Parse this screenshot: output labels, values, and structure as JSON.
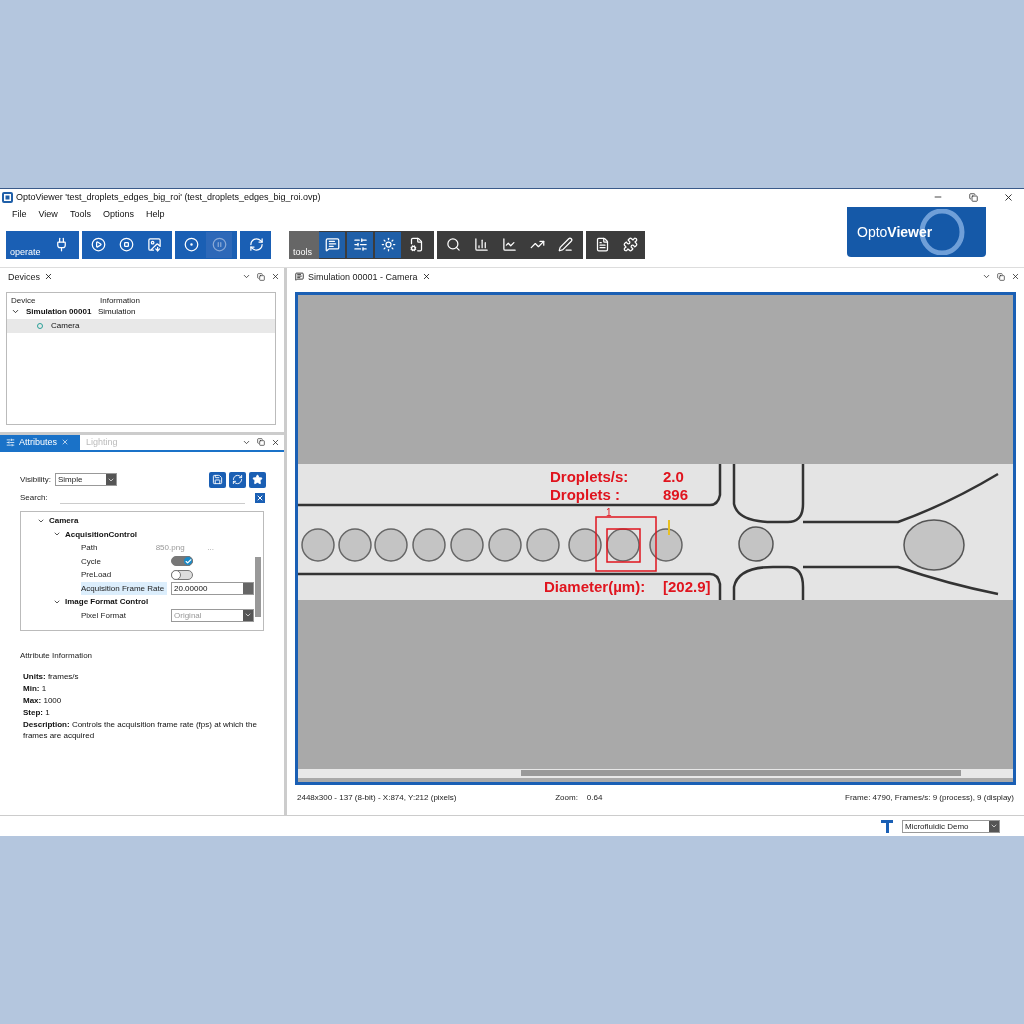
{
  "window": {
    "title": "OptoViewer 'test_droplets_edges_big_roi' (test_droplets_edges_big_roi.ovp)"
  },
  "menu": [
    "File",
    "View",
    "Tools",
    "Options",
    "Help"
  ],
  "toolbar": {
    "operate": {
      "label": "operate",
      "buttons": [
        {
          "kind": "plug",
          "disabled": false
        },
        {
          "kind": "play",
          "disabled": false
        },
        {
          "kind": "stop",
          "disabled": false
        },
        {
          "kind": "export",
          "disabled": false
        },
        {
          "kind": "record",
          "disabled": false
        },
        {
          "kind": "pause",
          "disabled": true
        },
        {
          "kind": "refresh",
          "disabled": false
        }
      ]
    },
    "tools": {
      "label": "tools",
      "buttons": [
        {
          "kind": "display",
          "selected": true
        },
        {
          "kind": "adjust",
          "selected": true
        },
        {
          "kind": "lighting",
          "selected": true
        },
        {
          "kind": "save-settings",
          "selected": false
        },
        {
          "kind": "search",
          "selected": false
        },
        {
          "kind": "histogram",
          "selected": false
        },
        {
          "kind": "profile",
          "selected": false
        },
        {
          "kind": "trend",
          "selected": false
        },
        {
          "kind": "pen",
          "selected": false
        },
        {
          "kind": "report",
          "selected": false
        },
        {
          "kind": "plugin",
          "selected": false
        }
      ]
    }
  },
  "logo": "Opto**Viewer**",
  "devices_panel": {
    "title": "Devices",
    "columns": [
      "Device",
      "Information"
    ],
    "tree": [
      {
        "name": "Simulation 00001",
        "info": "Simulation",
        "expanded": true,
        "selected": false,
        "children": [
          {
            "name": "Camera",
            "selected": true
          }
        ]
      }
    ]
  },
  "attributes_panel": {
    "tabs": [
      {
        "label": "Attributes",
        "selected": true
      },
      {
        "label": "Lighting",
        "selected": false
      }
    ],
    "visibility_label": "Visibility:",
    "visibility_value": "Simple",
    "search_label": "Search:",
    "tree": [
      {
        "name": "Camera",
        "expanded": true,
        "children": [
          {
            "name": "AcquisitionControl",
            "expanded": true,
            "rows": [
              {
                "kind": "text",
                "label": "Path",
                "value": "850.png",
                "extra": "...",
                "selected": false
              },
              {
                "kind": "toggle",
                "label": "Cycle",
                "on": true,
                "selected": false
              },
              {
                "kind": "toggle",
                "label": "PreLoad",
                "on": false,
                "selected": false
              },
              {
                "kind": "spin",
                "label": "Acquisition Frame Rate",
                "value": "20.00000",
                "selected": true
              }
            ]
          },
          {
            "name": "Image Format Control",
            "expanded": true,
            "rows": [
              {
                "kind": "dropdown",
                "label": "Pixel Format",
                "value": "Original",
                "selected": false,
                "disabled": true
              }
            ]
          }
        ]
      }
    ],
    "info_title": "Attribute Information",
    "info_lines": [
      "**Units:** frames/s",
      "**Min:** 1",
      "**Max:** 1000",
      "**Step:** 1",
      "**Description:** Controls the acquisition frame rate (fps) at which the frames are acquired"
    ]
  },
  "camera_panel": {
    "title": "Simulation 00001 - Camera",
    "overlay": {
      "rate_label": "Droplets/s:",
      "rate_value": "2.0",
      "count_label": "Droplets :",
      "count_value": "896",
      "diameter_label": "Diameter(µm):",
      "diameter_value": "[202.9]",
      "roi_label": "1"
    },
    "info_left": "2448x300 - 137 (8-bit) - X:874, Y:212 (pixels)",
    "zoom_label": "Zoom:",
    "zoom_value": "0.64",
    "info_right": "Frame: 4790, Frames/s: 9 (process), 9 (display)"
  },
  "status_bar": {
    "profile": "Microfluidic Demo"
  }
}
